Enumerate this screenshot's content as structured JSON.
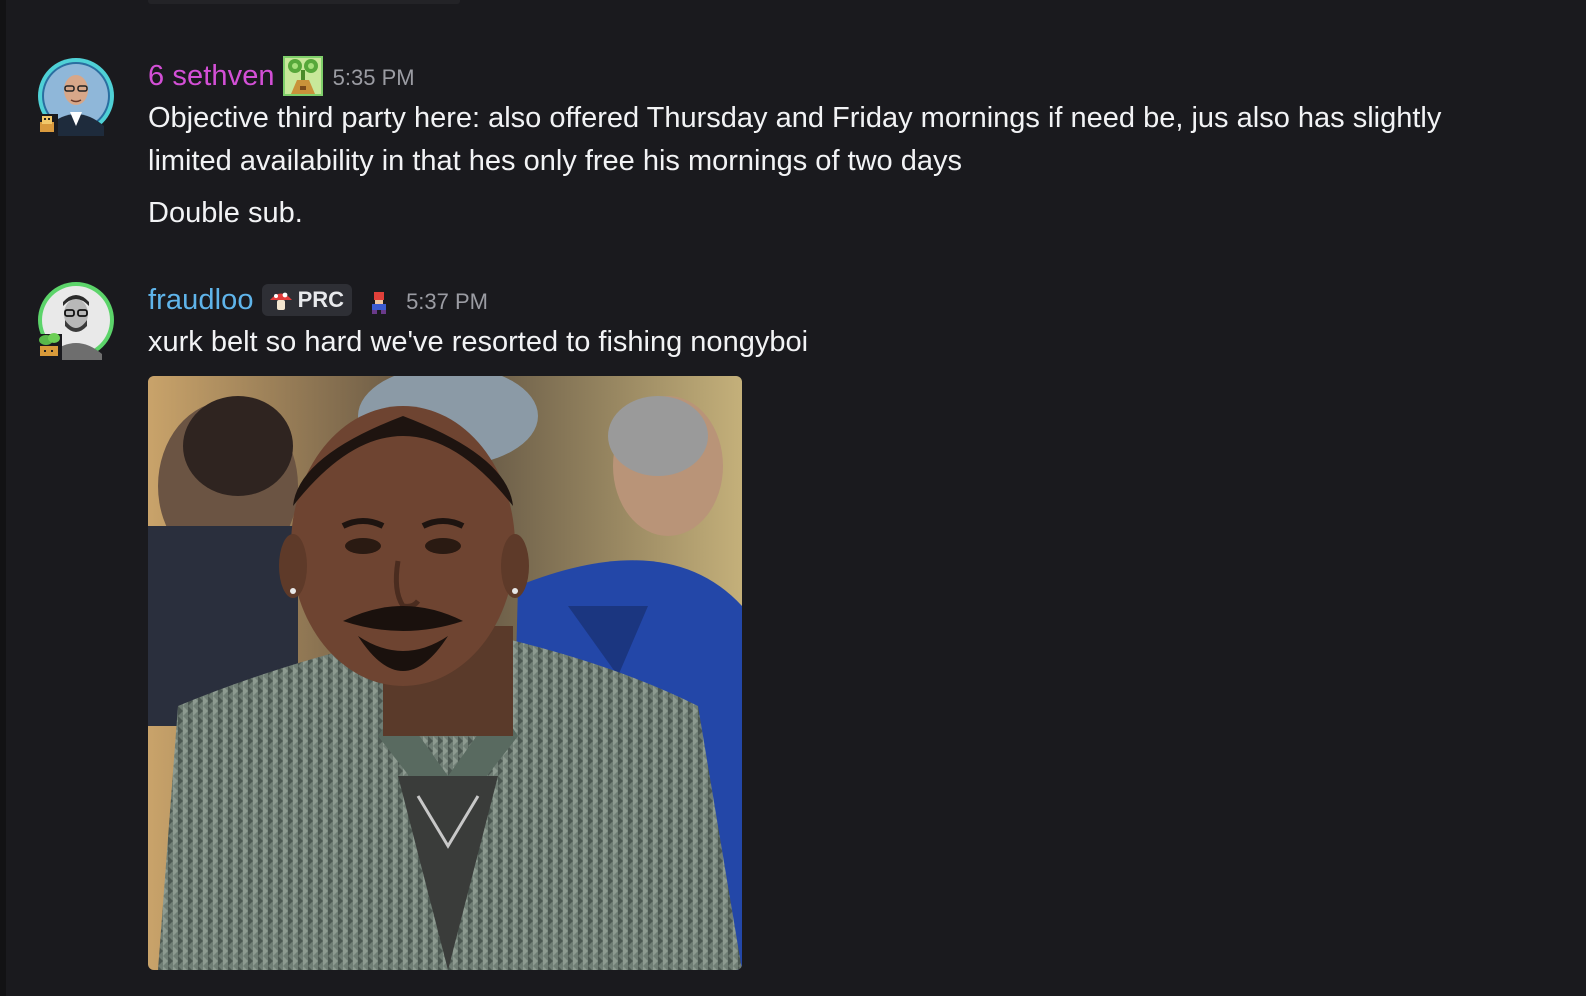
{
  "messages": [
    {
      "username": "6 sethven",
      "username_color": "#d34fd6",
      "timestamp": "5:35 PM",
      "avatar_icon": "bald-man-glasses-avatar-icon",
      "role_icon": "plant-badge-icon",
      "lines": [
        "Objective third party here: also offered Thursday and Friday mornings if need be, jus also has slightly",
        "limited availability in that hes only free his mornings of two days",
        "Double sub."
      ]
    },
    {
      "username": "fraudloo",
      "username_color": "#5fb4ea",
      "timestamp": "5:37 PM",
      "avatar_icon": "bearded-man-glasses-avatar-icon",
      "tag": "PRC",
      "tag_icon": "mushroom-icon",
      "extra_icon": "pixel-character-icon",
      "lines": [
        "xurk belt so hard we've resorted to fishing nongyboi"
      ],
      "attachment": "image-attachment"
    }
  ]
}
